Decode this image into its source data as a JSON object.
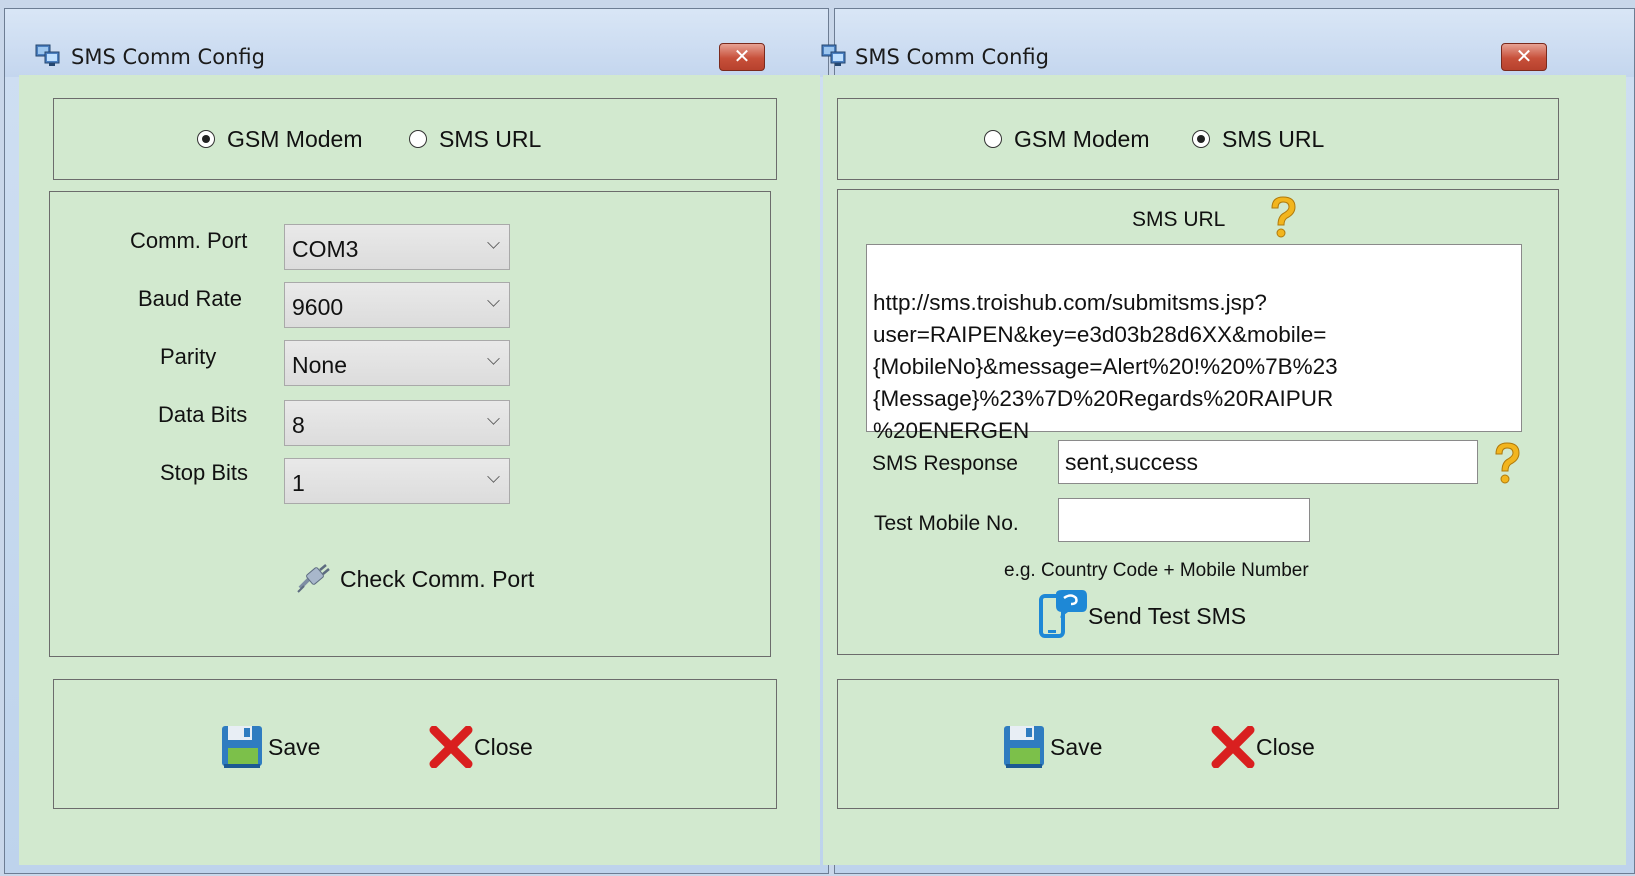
{
  "left_window": {
    "title": "SMS Comm Config",
    "close_glyph": "✕",
    "mode": {
      "options": [
        "GSM Modem",
        "SMS URL"
      ],
      "selected": "GSM Modem"
    },
    "fields": [
      {
        "label": "Comm. Port",
        "value": "COM3"
      },
      {
        "label": "Baud Rate",
        "value": "9600"
      },
      {
        "label": "Parity",
        "value": "None"
      },
      {
        "label": "Data Bits",
        "value": "8"
      },
      {
        "label": "Stop Bits",
        "value": "1"
      }
    ],
    "check_port_label": "Check Comm. Port",
    "save_label": "Save",
    "close_label": "Close"
  },
  "right_window": {
    "title": "SMS Comm Config",
    "close_glyph": "✕",
    "mode": {
      "options": [
        "GSM Modem",
        "SMS URL"
      ],
      "selected": "SMS URL"
    },
    "url_heading": "SMS URL",
    "url_value": "http://sms.troishub.com/submitsms.jsp?\nuser=RAIPEN&key=e3d03b28d6XX&mobile=\n{MobileNo}&message=Alert%20!%20%7B%23\n{Message}%23%7D%20Regards%20RAIPUR\n%20ENERGEN",
    "response_label": "SMS Response",
    "response_value": "sent,success",
    "test_mobile_label": "Test Mobile No.",
    "test_mobile_value": "",
    "hint": "e.g. Country Code + Mobile Number",
    "send_test_label": "Send Test SMS",
    "save_label": "Save",
    "close_label": "Close"
  },
  "colors": {
    "client_bg": "#d2e9cf",
    "title_bg": "#c4d6ee",
    "close_button": "#c7503a"
  },
  "icons": [
    "window-icon",
    "help-icon",
    "plug-icon",
    "phone-sms-icon",
    "save-icon",
    "close-red-x-icon"
  ]
}
